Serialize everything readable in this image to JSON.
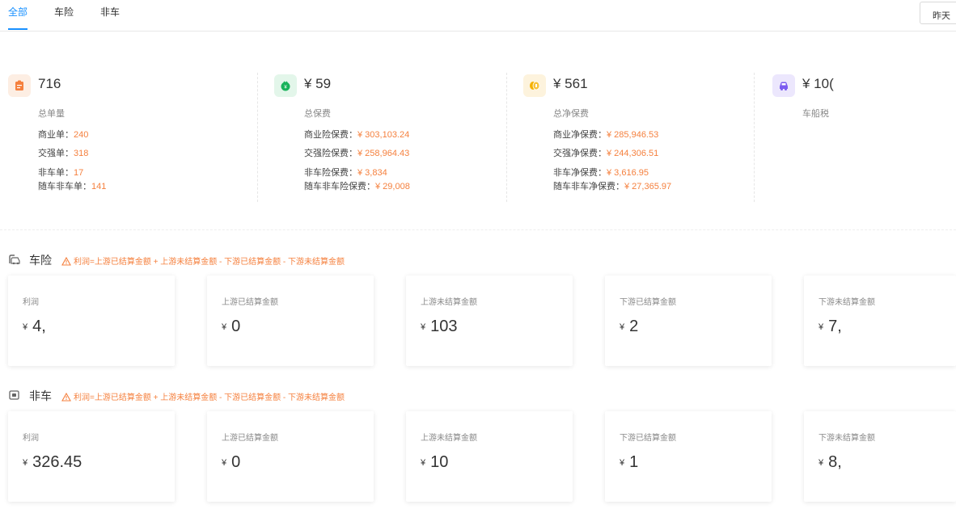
{
  "tabs": [
    {
      "label": "全部",
      "active": true
    },
    {
      "label": "车险",
      "active": false
    },
    {
      "label": "非车",
      "active": false
    }
  ],
  "date_filter": {
    "label": "昨天"
  },
  "summary": [
    {
      "icon": "clipboard-icon",
      "icon_color": "#f5803e",
      "icon_bg": "#fdeee3",
      "value": "716",
      "label": "总单量",
      "lines": [
        {
          "label": "商业单：",
          "value": "240"
        },
        {
          "label": "交强单：",
          "value": "318"
        },
        {
          "label": "非车单：",
          "value": "17"
        },
        {
          "label": "随车非车单：",
          "value": "141"
        }
      ]
    },
    {
      "icon": "money-bag-icon",
      "icon_color": "#19b35b",
      "icon_bg": "#e3f6ea",
      "value": "¥ 59",
      "label": "总保费",
      "lines": [
        {
          "label": "商业险保费：",
          "value": "¥ 303,103.24"
        },
        {
          "label": "交强险保费：",
          "value": "¥ 258,964.43"
        },
        {
          "label": "非车险保费：",
          "value": "¥ 3,834"
        },
        {
          "label": "随车非车险保费：",
          "value": "¥ 29,008"
        }
      ]
    },
    {
      "icon": "coins-icon",
      "icon_color": "#f5b100",
      "icon_bg": "#fdf3dd",
      "value": "¥ 561",
      "label": "总净保费",
      "lines": [
        {
          "label": "商业净保费：",
          "value": "¥ 285,946.53"
        },
        {
          "label": "交强净保费：",
          "value": "¥ 244,306.51"
        },
        {
          "label": "非车净保费：",
          "value": "¥ 3,616.95"
        },
        {
          "label": "随车非车净保费：",
          "value": "¥ 27,365.97"
        }
      ]
    },
    {
      "icon": "car-icon",
      "icon_color": "#7b5cf0",
      "icon_bg": "#ece7fd",
      "value": "¥ 10(",
      "label": "车船税",
      "lines": []
    }
  ],
  "sections": [
    {
      "title": "车险",
      "icon": "car-insurance-icon",
      "formula": "利润=上游已结算金额 + 上游未结算金额 - 下游已结算金额 - 下游未结算金额",
      "cards": [
        {
          "label": "利润",
          "currency": "¥",
          "value": "4,"
        },
        {
          "label": "上游已结算金额",
          "currency": "¥",
          "value": "0"
        },
        {
          "label": "上游未结算金额",
          "currency": "¥",
          "value": "103"
        },
        {
          "label": "下游已结算金额",
          "currency": "¥",
          "value": "2"
        },
        {
          "label": "下游未结算金额",
          "currency": "¥",
          "value": "7,"
        }
      ]
    },
    {
      "title": "非车",
      "icon": "non-car-insurance-icon",
      "formula": "利润=上游已结算金额 + 上游未结算金额 - 下游已结算金额 - 下游未结算金额",
      "cards": [
        {
          "label": "利润",
          "currency": "¥",
          "value": "326.45"
        },
        {
          "label": "上游已结算金额",
          "currency": "¥",
          "value": "0"
        },
        {
          "label": "上游未结算金额",
          "currency": "¥",
          "value": "10"
        },
        {
          "label": "下游已结算金额",
          "currency": "¥",
          "value": "1"
        },
        {
          "label": "下游未结算金额",
          "currency": "¥",
          "value": "8,"
        }
      ]
    }
  ],
  "colors": {
    "accent": "#1890ff",
    "highlight": "#f5803e"
  }
}
